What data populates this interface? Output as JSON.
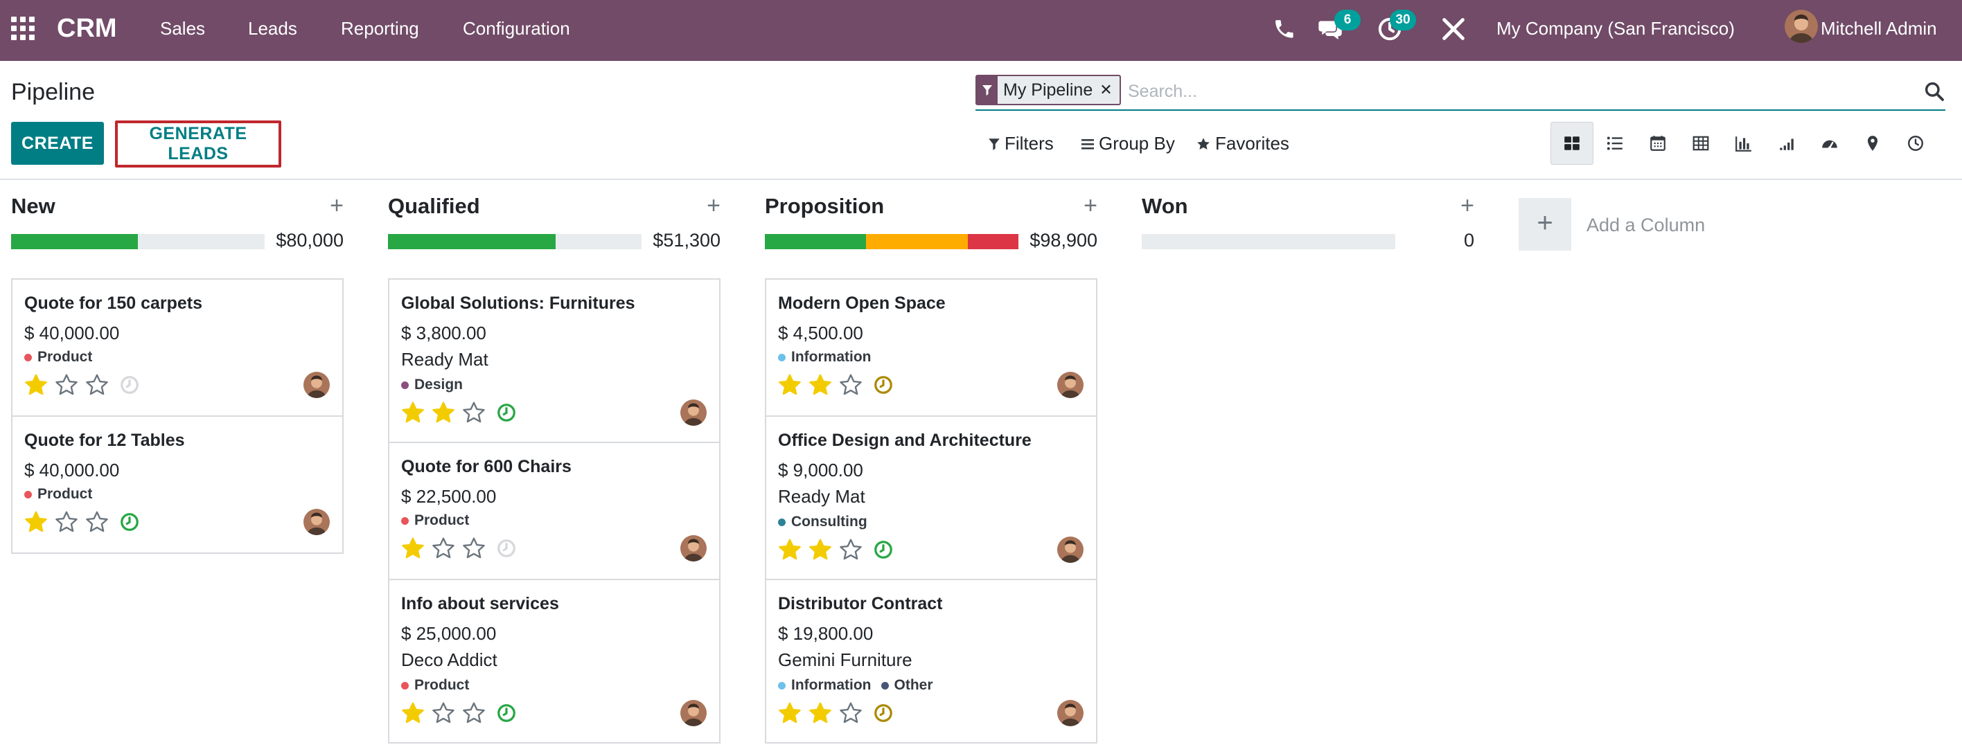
{
  "navbar": {
    "app_name": "CRM",
    "menus": [
      "Sales",
      "Leads",
      "Reporting",
      "Configuration"
    ],
    "messages_count": "6",
    "activities_count": "30",
    "company": "My Company (San Francisco)",
    "user": "Mitchell Admin",
    "color": "#714b67"
  },
  "control": {
    "breadcrumb": "Pipeline",
    "create_label": "CREATE",
    "generate_label": "GENERATE LEADS",
    "facet_label": "My Pipeline",
    "search_placeholder": "Search...",
    "filters_label": "Filters",
    "groupby_label": "Group By",
    "favorites_label": "Favorites"
  },
  "columns": [
    {
      "title": "New",
      "total": "$80,000",
      "progress": [
        {
          "color": "#28a745",
          "fraction": 0.5
        }
      ],
      "cards": [
        {
          "title": "Quote for 150 carpets",
          "amount": "$ 40,000.00",
          "partner": "",
          "tags": [
            {
              "name": "Product",
              "color": "#e8555a"
            }
          ],
          "stars": 1,
          "activity": "none"
        },
        {
          "title": "Quote for 12 Tables",
          "amount": "$ 40,000.00",
          "partner": "",
          "tags": [
            {
              "name": "Product",
              "color": "#e8555a"
            }
          ],
          "stars": 1,
          "activity": "ok"
        }
      ]
    },
    {
      "title": "Qualified",
      "total": "$51,300",
      "progress": [
        {
          "color": "#28a745",
          "fraction": 0.66
        }
      ],
      "cards": [
        {
          "title": "Global Solutions: Furnitures",
          "amount": "$ 3,800.00",
          "partner": "Ready Mat",
          "tags": [
            {
              "name": "Design",
              "color": "#8a4f7d"
            }
          ],
          "stars": 2,
          "activity": "ok"
        },
        {
          "title": "Quote for 600 Chairs",
          "amount": "$ 22,500.00",
          "partner": "",
          "tags": [
            {
              "name": "Product",
              "color": "#e8555a"
            }
          ],
          "stars": 1,
          "activity": "none"
        },
        {
          "title": "Info about services",
          "amount": "$ 25,000.00",
          "partner": "Deco Addict",
          "tags": [
            {
              "name": "Product",
              "color": "#e8555a"
            }
          ],
          "stars": 1,
          "activity": "ok"
        }
      ]
    },
    {
      "title": "Proposition",
      "total": "$98,900",
      "progress": [
        {
          "color": "#28a745",
          "fraction": 0.4
        },
        {
          "color": "#ffac00",
          "fraction": 0.4
        },
        {
          "color": "#dc3545",
          "fraction": 0.2
        }
      ],
      "cards": [
        {
          "title": "Modern Open Space",
          "amount": "$ 4,500.00",
          "partner": "",
          "tags": [
            {
              "name": "Information",
              "color": "#6cc1ed"
            }
          ],
          "stars": 2,
          "activity": "warn"
        },
        {
          "title": "Office Design and Architecture",
          "amount": "$ 9,000.00",
          "partner": "Ready Mat",
          "tags": [
            {
              "name": "Consulting",
              "color": "#2c8397"
            }
          ],
          "stars": 2,
          "activity": "ok"
        },
        {
          "title": "Distributor Contract",
          "amount": "$ 19,800.00",
          "partner": "Gemini Furniture",
          "tags": [
            {
              "name": "Information",
              "color": "#6cc1ed"
            },
            {
              "name": "Other",
              "color": "#475577"
            }
          ],
          "stars": 2,
          "activity": "warn"
        }
      ]
    },
    {
      "title": "Won",
      "total": "0",
      "progress": [],
      "cards": []
    }
  ],
  "add_column_label": "Add a Column"
}
